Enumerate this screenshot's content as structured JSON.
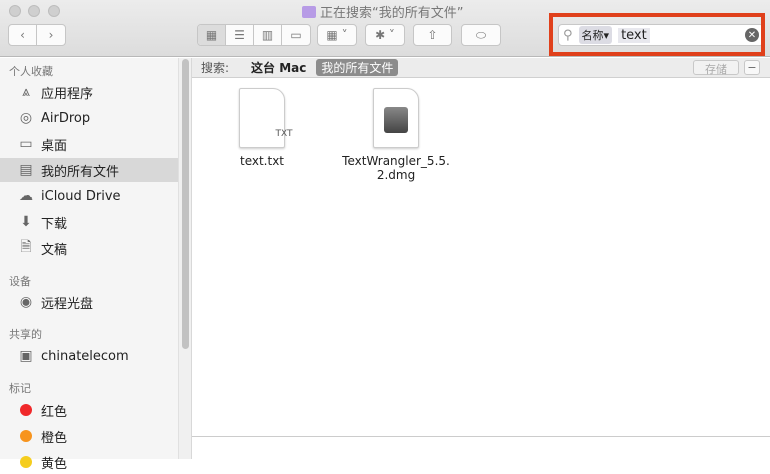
{
  "window": {
    "title": "正在搜索“我的所有文件”"
  },
  "search": {
    "token": "名称▾",
    "value": "text"
  },
  "scope": {
    "label": "搜索:",
    "this_mac": "这台 Mac",
    "all_files": "我的所有文件",
    "save": "存储",
    "remove": "−"
  },
  "sidebar": {
    "favorites": "个人收藏",
    "items": [
      {
        "label": "应用程序"
      },
      {
        "label": "AirDrop"
      },
      {
        "label": "桌面"
      },
      {
        "label": "我的所有文件"
      },
      {
        "label": "iCloud Drive"
      },
      {
        "label": "下载"
      },
      {
        "label": "文稿"
      }
    ],
    "devices": "设备",
    "device_items": [
      {
        "label": "远程光盘"
      }
    ],
    "shared": "共享的",
    "shared_items": [
      {
        "label": "chinatelecom"
      }
    ],
    "tags": "标记",
    "tag_items": [
      {
        "label": "红色",
        "color": "#f0282a"
      },
      {
        "label": "橙色",
        "color": "#f7941e"
      },
      {
        "label": "黄色",
        "color": "#f5cd1e"
      }
    ]
  },
  "files": [
    {
      "name": "text.txt",
      "badge": "TXT"
    },
    {
      "name": "TextWrangler_5.5.2.dmg"
    }
  ]
}
